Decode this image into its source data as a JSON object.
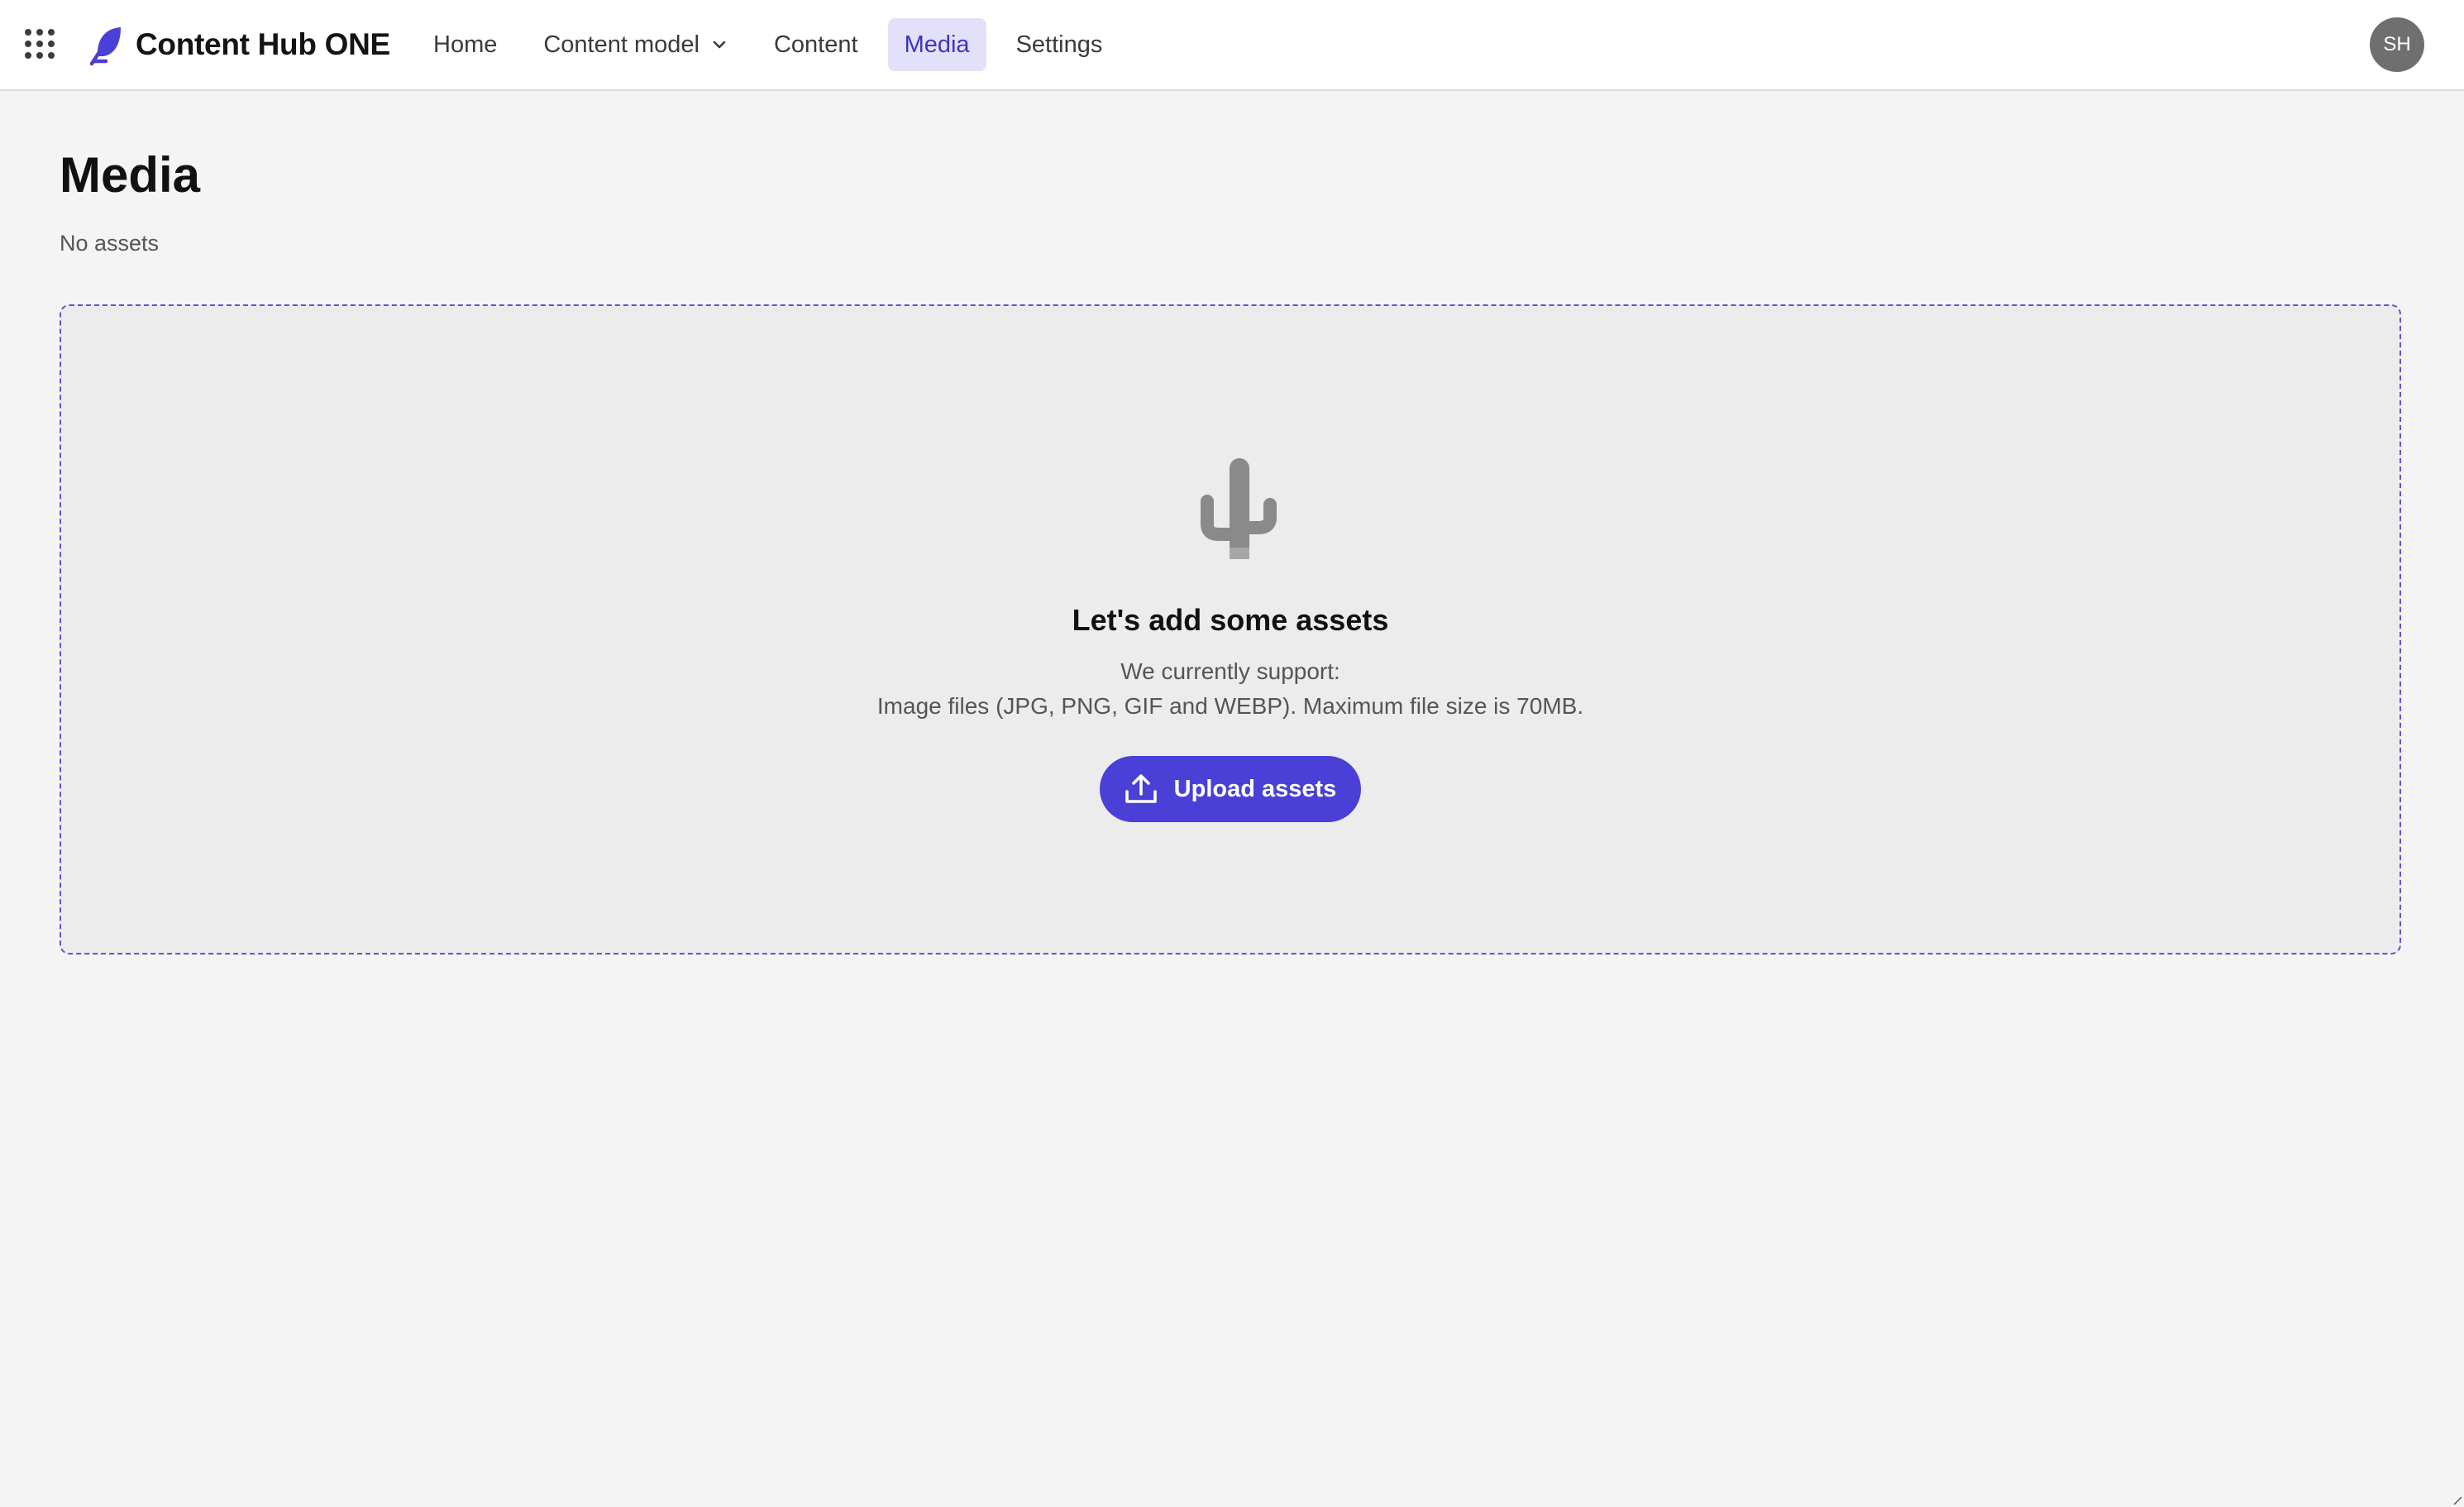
{
  "app": {
    "brand_name": "Content Hub ONE",
    "accent_color": "#4a3fd6"
  },
  "topbar": {
    "app_switcher_icon": "grid-dots-icon",
    "logo_icon": "feather-logo-icon",
    "nav": {
      "home": "Home",
      "content_model": "Content model",
      "content": "Content",
      "media": "Media",
      "settings": "Settings"
    },
    "active_nav": "Media",
    "user_initials": "SH"
  },
  "page": {
    "title": "Media",
    "subtitle": "No assets"
  },
  "empty_state": {
    "icon": "cactus-icon",
    "title": "Let's add some assets",
    "support_line1": "We currently support:",
    "support_line2": "Image files (JPG, PNG, GIF and WEBP). Maximum file size is 70MB.",
    "upload_button_label": "Upload assets",
    "upload_icon": "upload-icon"
  }
}
